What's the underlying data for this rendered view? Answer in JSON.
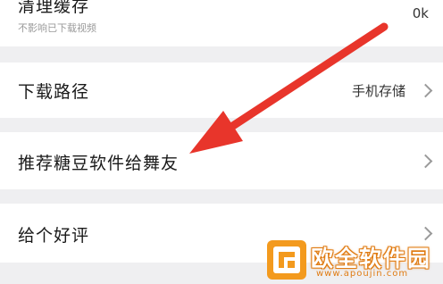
{
  "settings": {
    "clear_cache": {
      "label": "清理缓存",
      "subtitle": "不影响已下载视频",
      "value": "0k"
    },
    "download_path": {
      "label": "下载路径",
      "value": "手机存储"
    },
    "recommend": {
      "label": "推荐糖豆软件给舞友"
    },
    "rate": {
      "label": "给个好评"
    }
  },
  "watermark": {
    "title": "欧全软件园",
    "url": "www.apoujin.com"
  },
  "annotation": {
    "arrow_color": "#e8352b"
  },
  "icons": [
    "chevron-right-icon",
    "watermark-logo-icon",
    "red-arrow-annotation"
  ]
}
